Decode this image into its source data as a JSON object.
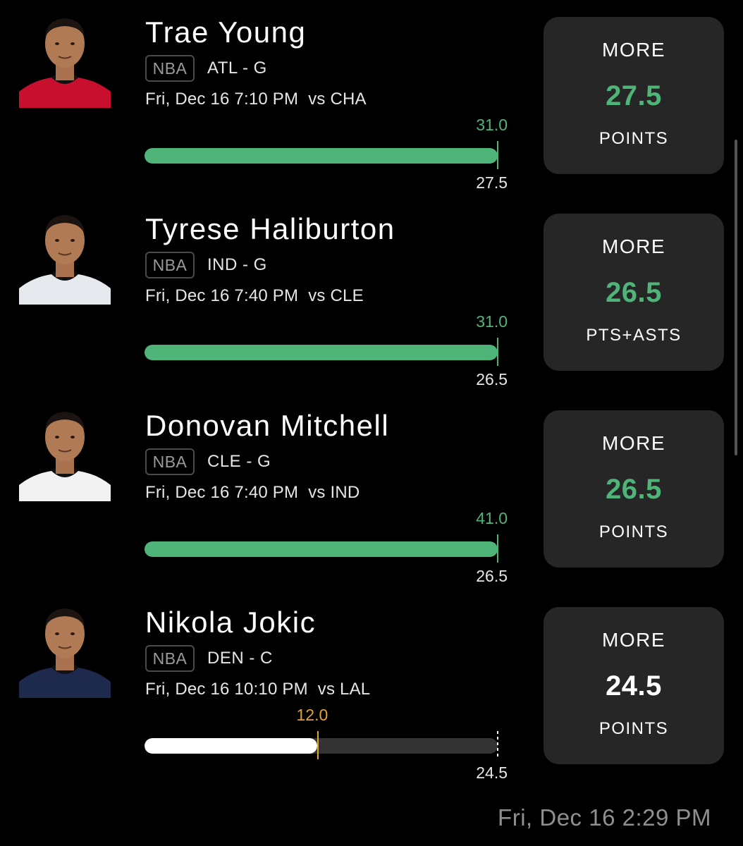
{
  "colors": {
    "green": "#4fb477",
    "orange": "#e0a33a",
    "white": "#ffffff",
    "track": "#333333",
    "card": "#262626"
  },
  "picks": [
    {
      "player": "Trae Young",
      "league": "NBA",
      "team_pos": "ATL - G",
      "game_time": "Fri, Dec 16 7:10 PM",
      "opponent": "vs CHA",
      "actual": "31.0",
      "target": "27.5",
      "progress": 1.0,
      "status": "hit",
      "direction": "MORE",
      "line": "27.5",
      "stat": "POINTS",
      "avatar_icon": "player-headshot-icon",
      "jersey_color": "#c8102e"
    },
    {
      "player": "Tyrese Haliburton",
      "league": "NBA",
      "team_pos": "IND - G",
      "game_time": "Fri, Dec 16 7:40 PM",
      "opponent": "vs CLE",
      "actual": "31.0",
      "target": "26.5",
      "progress": 1.0,
      "status": "hit",
      "direction": "MORE",
      "line": "26.5",
      "stat": "PTS+ASTS",
      "avatar_icon": "player-headshot-icon",
      "jersey_color": "#e6e9ee"
    },
    {
      "player": "Donovan Mitchell",
      "league": "NBA",
      "team_pos": "CLE - G",
      "game_time": "Fri, Dec 16 7:40 PM",
      "opponent": "vs IND",
      "actual": "41.0",
      "target": "26.5",
      "progress": 1.0,
      "status": "hit",
      "direction": "MORE",
      "line": "26.5",
      "stat": "POINTS",
      "avatar_icon": "player-headshot-icon",
      "jersey_color": "#f2f2f2"
    },
    {
      "player": "Nikola Jokic",
      "league": "NBA",
      "team_pos": "DEN - C",
      "game_time": "Fri, Dec 16 10:10 PM",
      "opponent": "vs LAL",
      "actual": "12.0",
      "target": "24.5",
      "progress": 0.49,
      "status": "live",
      "direction": "MORE",
      "line": "24.5",
      "stat": "POINTS",
      "avatar_icon": "player-headshot-icon",
      "jersey_color": "#1d2a4d"
    }
  ],
  "timestamp": "Fri, Dec 16 2:29 PM"
}
